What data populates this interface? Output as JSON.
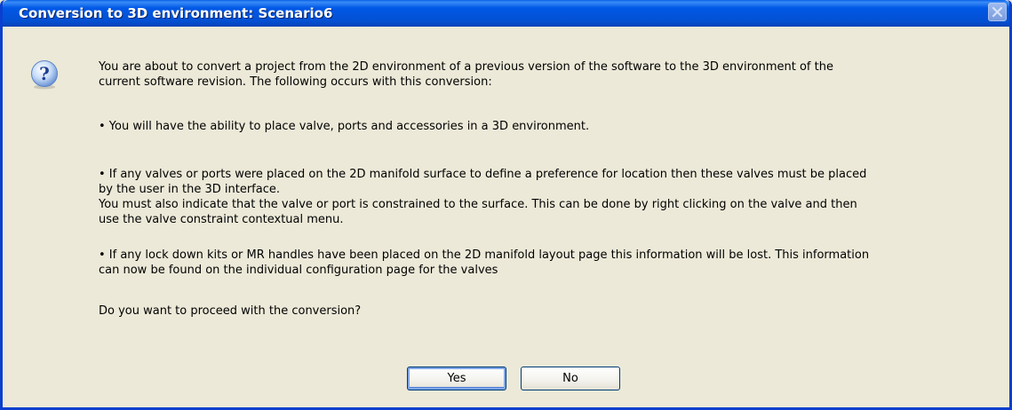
{
  "window": {
    "title": "Conversion to 3D environment: Scenario6"
  },
  "icons": {
    "dialog_icon": "question-icon",
    "close": "close-icon"
  },
  "message": {
    "intro": "You are about to convert a project from the 2D environment of a previous version of the software to the 3D environment of the\ncurrent software revision.  The following occurs with this conversion:",
    "bullet1": "• You will have the ability to place valve, ports and accessories in a 3D environment.",
    "bullet2": "• If any valves or ports were placed on the 2D manifold surface to define a preference for location then these valves must be placed\nby the user in the 3D interface.\nYou must also indicate that the valve or port  is constrained to the surface.  This can be done by right clicking on the valve and then\nuse the valve constraint contextual menu.",
    "bullet3": "• If any lock down kits or MR handles have been placed on the 2D manifold layout page this information will be lost.  This information\ncan now be found on the individual configuration page for the valves",
    "question": "Do you want to proceed with the conversion?"
  },
  "buttons": {
    "yes": "Yes",
    "no": "No"
  },
  "colors": {
    "titlebar": "#0058e6",
    "dialog_bg": "#ece9d8",
    "border": "#0a3fcf"
  }
}
